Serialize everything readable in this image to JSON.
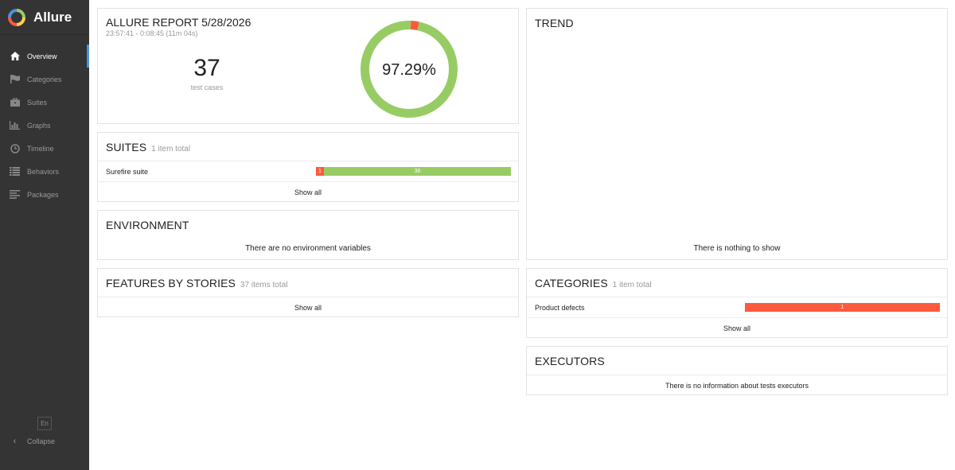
{
  "app": {
    "name": "Allure"
  },
  "sidebar": {
    "items": [
      {
        "label": "Overview",
        "icon": "home-icon",
        "active": true
      },
      {
        "label": "Categories",
        "icon": "flag-icon",
        "active": false
      },
      {
        "label": "Suites",
        "icon": "briefcase-icon",
        "active": false
      },
      {
        "label": "Graphs",
        "icon": "bar-chart-icon",
        "active": false
      },
      {
        "label": "Timeline",
        "icon": "clock-icon",
        "active": false
      },
      {
        "label": "Behaviors",
        "icon": "list-icon",
        "active": false
      },
      {
        "label": "Packages",
        "icon": "align-left-icon",
        "active": false
      }
    ],
    "language": "En",
    "collapse_label": "Collapse"
  },
  "summary": {
    "title": "ALLURE REPORT 5/28/2026",
    "time": "23:57:41 - 0:08:45 (11m 04s)",
    "count": "37",
    "count_label": "test cases",
    "percent": "97.29%",
    "passed": 36,
    "failed": 1
  },
  "suites": {
    "title": "SUITES",
    "subtitle": "1 item total",
    "rows": [
      {
        "name": "Surefire suite",
        "failed": "1",
        "passed": "36"
      }
    ],
    "show_all": "Show all"
  },
  "environment": {
    "title": "ENVIRONMENT",
    "message": "There are no environment variables"
  },
  "features": {
    "title": "FEATURES BY STORIES",
    "subtitle": "37 items total",
    "show_all": "Show all"
  },
  "trend": {
    "title": "TREND",
    "message": "There is nothing to show"
  },
  "categories": {
    "title": "CATEGORIES",
    "subtitle": "1 item total",
    "rows": [
      {
        "name": "Product defects",
        "count": "1"
      }
    ],
    "show_all": "Show all"
  },
  "executors": {
    "title": "EXECUTORS",
    "message": "There is no information about tests executors"
  },
  "colors": {
    "passed": "#97cc64",
    "failed": "#fd5a3e",
    "sidebar": "#343434",
    "accent": "#4a93d8"
  }
}
